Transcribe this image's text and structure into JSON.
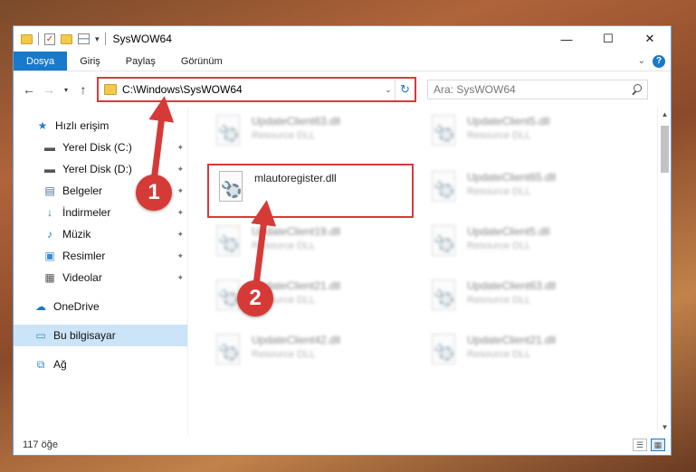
{
  "window": {
    "title": "SysWOW64",
    "controls": {
      "minimize": "—",
      "maximize": "☐",
      "close": "✕"
    }
  },
  "ribbon": {
    "tabs": [
      "Dosya",
      "Giriş",
      "Paylaş",
      "Görünüm"
    ],
    "active_tab": "Dosya",
    "expand_icon": "chevron-down-icon",
    "help": "?"
  },
  "nav": {
    "back": "←",
    "forward": "→",
    "recent": "▾",
    "up": "↑"
  },
  "address": {
    "path": "C:\\Windows\\SysWOW64",
    "dropdown": "⌄",
    "refresh": "↻"
  },
  "search": {
    "placeholder": "Ara: SysWOW64"
  },
  "sidebar": {
    "items": [
      {
        "label": "Hızlı erişim",
        "icon": "star-icon",
        "glyph": "★",
        "color": "#2a7ad5"
      },
      {
        "label": "Yerel Disk (C:)",
        "icon": "drive-icon",
        "glyph": "▬",
        "color": "#555",
        "pinned": true
      },
      {
        "label": "Yerel Disk (D:)",
        "icon": "drive-icon",
        "glyph": "▬",
        "color": "#555",
        "pinned": true
      },
      {
        "label": "Belgeler",
        "icon": "documents-icon",
        "glyph": "▤",
        "color": "#4a6f9a",
        "pinned": true
      },
      {
        "label": "İndirmeler",
        "icon": "downloads-icon",
        "glyph": "↓",
        "color": "#1979ca",
        "pinned": true
      },
      {
        "label": "Müzik",
        "icon": "music-icon",
        "glyph": "♪",
        "color": "#1979ca",
        "pinned": true
      },
      {
        "label": "Resimler",
        "icon": "pictures-icon",
        "glyph": "▣",
        "color": "#3a8ad0",
        "pinned": true
      },
      {
        "label": "Videolar",
        "icon": "videos-icon",
        "glyph": "▦",
        "color": "#555",
        "pinned": true
      },
      {
        "label": "OneDrive",
        "icon": "onedrive-icon",
        "glyph": "☁",
        "color": "#1979ca"
      },
      {
        "label": "Bu bilgisayar",
        "icon": "computer-icon",
        "glyph": "▭",
        "color": "#3a8ad0",
        "selected": true
      },
      {
        "label": "Ağ",
        "icon": "network-icon",
        "glyph": "⧉",
        "color": "#3a8ad0"
      }
    ],
    "pin_glyph": "📌"
  },
  "files": [
    {
      "name": "UpdateClient63.dll",
      "type": "Resource DLL"
    },
    {
      "name": "UpdateClient5.dll",
      "type": "Resource DLL"
    },
    {
      "name": "mlautoregister.dll",
      "type": ""
    },
    {
      "name": "UpdateClient65.dll",
      "type": "Resource DLL"
    },
    {
      "name": "UpdateClient19.dll",
      "type": "Resource DLL"
    },
    {
      "name": "UpdateClient5.dll",
      "type": "Resource DLL"
    },
    {
      "name": "UpdateClient21.dll",
      "type": "Resource DLL"
    },
    {
      "name": "UpdateClient63.dll",
      "type": "Resource DLL"
    },
    {
      "name": "UpdateClient42.dll",
      "type": "Resource DLL"
    },
    {
      "name": "UpdateClient21.dll",
      "type": "Resource DLL"
    }
  ],
  "status": {
    "count": "117 öğe"
  },
  "annotations": {
    "marker1": "1",
    "marker2": "2",
    "color": "#d63a37"
  }
}
